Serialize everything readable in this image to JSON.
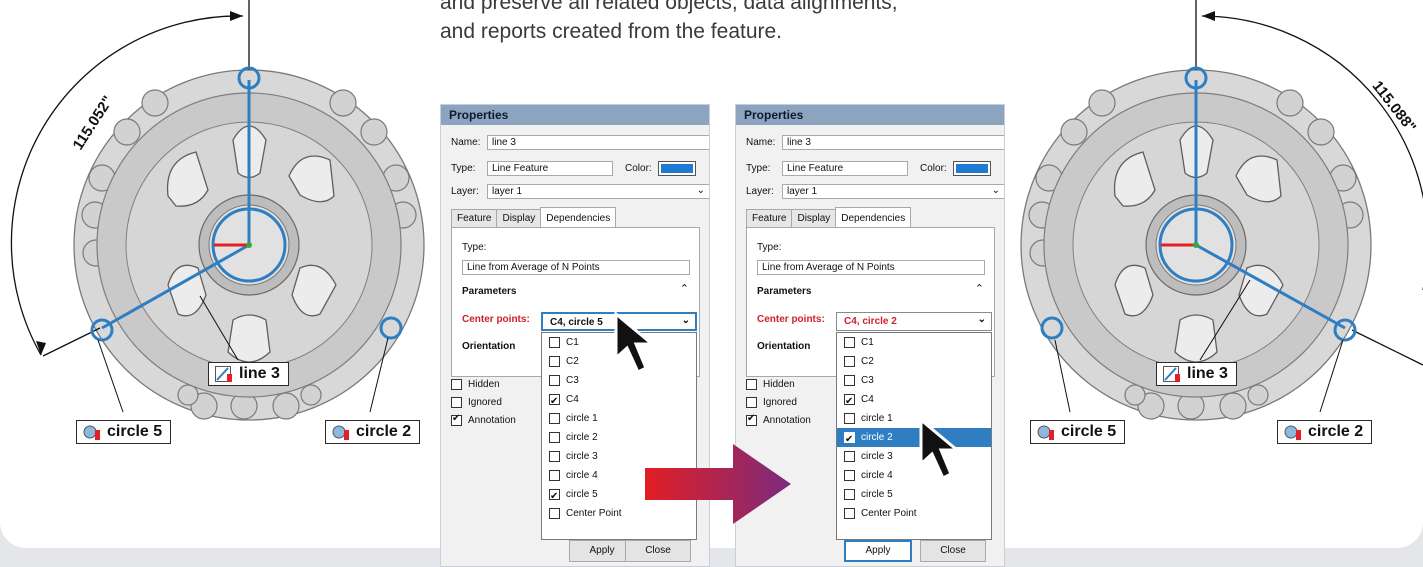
{
  "intro": {
    "line1": "and preserve all related objects, data alignments,",
    "line2": "and reports created from the feature."
  },
  "left_part": {
    "dimension": "115.052\"",
    "callouts": {
      "line": "line 3",
      "circle_a": "circle 5",
      "circle_b": "circle 2"
    }
  },
  "right_part": {
    "dimension": "115.088\"",
    "callouts": {
      "line": "line 3",
      "circle_a": "circle 5",
      "circle_b": "circle 2"
    }
  },
  "dialog_left": {
    "title": "Properties",
    "name_label": "Name:",
    "name_value": "line 3",
    "type_label": "Type:",
    "type_value": "Line Feature",
    "color_label": "Color:",
    "layer_label": "Layer:",
    "layer_value": "layer 1",
    "tabs": [
      "Feature",
      "Display",
      "Dependencies"
    ],
    "panel_type_label": "Type:",
    "panel_type_value": "Line from Average of N Points",
    "parameters_label": "Parameters",
    "center_points_label": "Center points:",
    "center_points_value": "C4, circle 5",
    "orientation_label": "Orientation",
    "options": [
      {
        "label": "Hidden",
        "checked": false
      },
      {
        "label": "Ignored",
        "checked": false
      },
      {
        "label": "Annotation",
        "checked": true
      }
    ],
    "dropdown_items": [
      {
        "label": "C1",
        "checked": false
      },
      {
        "label": "C2",
        "checked": false
      },
      {
        "label": "C3",
        "checked": false
      },
      {
        "label": "C4",
        "checked": true
      },
      {
        "label": "circle 1",
        "checked": false
      },
      {
        "label": "circle 2",
        "checked": false
      },
      {
        "label": "circle 3",
        "checked": false
      },
      {
        "label": "circle 4",
        "checked": false
      },
      {
        "label": "circle 5",
        "checked": true
      },
      {
        "label": "Center Point",
        "checked": false
      }
    ],
    "apply_label": "Apply",
    "close_label": "Close"
  },
  "dialog_right": {
    "title": "Properties",
    "name_label": "Name:",
    "name_value": "line 3",
    "type_label": "Type:",
    "type_value": "Line Feature",
    "color_label": "Color:",
    "layer_label": "Layer:",
    "layer_value": "layer 1",
    "tabs": [
      "Feature",
      "Display",
      "Dependencies"
    ],
    "panel_type_label": "Type:",
    "panel_type_value": "Line from Average of N Points",
    "parameters_label": "Parameters",
    "center_points_label": "Center points:",
    "center_points_value": "C4, circle 2",
    "orientation_label": "Orientation",
    "options": [
      {
        "label": "Hidden",
        "checked": false
      },
      {
        "label": "Ignored",
        "checked": false
      },
      {
        "label": "Annotation",
        "checked": true
      }
    ],
    "dropdown_items": [
      {
        "label": "C1",
        "checked": false
      },
      {
        "label": "C2",
        "checked": false
      },
      {
        "label": "C3",
        "checked": false
      },
      {
        "label": "C4",
        "checked": true
      },
      {
        "label": "circle 1",
        "checked": false
      },
      {
        "label": "circle 2",
        "checked": true,
        "selected": true
      },
      {
        "label": "circle 3",
        "checked": false
      },
      {
        "label": "circle 4",
        "checked": false
      },
      {
        "label": "circle 5",
        "checked": false
      },
      {
        "label": "Center Point",
        "checked": false
      }
    ],
    "apply_label": "Apply",
    "close_label": "Close"
  },
  "colors": {
    "accent_blue": "#2f7ec2",
    "title_bar": "#8da4c1",
    "required_red": "#d0202a",
    "arrow_red": "#e31e24",
    "arrow_purple": "#7a2b7e",
    "part_gray": "#c8c8c8"
  },
  "icons": {
    "line_callout": "line-feature-icon",
    "circle_callout": "circle-feature-icon",
    "cursor": "mouse-pointer-icon",
    "collapse": "double-chevron-up-icon",
    "dropdown": "chevron-down-icon"
  }
}
